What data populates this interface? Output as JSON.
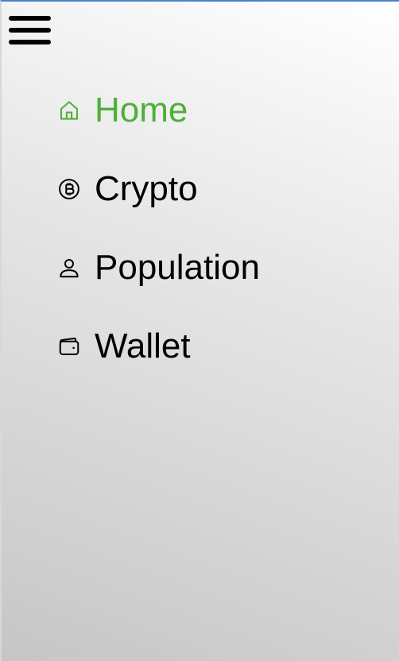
{
  "menu": {
    "toggle_icon": "hamburger-menu-icon",
    "active_color": "#4fae3a",
    "text_color": "#000000",
    "items": [
      {
        "label": "Home",
        "icon": "home-icon",
        "active": true
      },
      {
        "label": "Crypto",
        "icon": "bitcoin-icon",
        "active": false
      },
      {
        "label": "Population",
        "icon": "person-icon",
        "active": false
      },
      {
        "label": "Wallet",
        "icon": "wallet-icon",
        "active": false
      }
    ]
  }
}
